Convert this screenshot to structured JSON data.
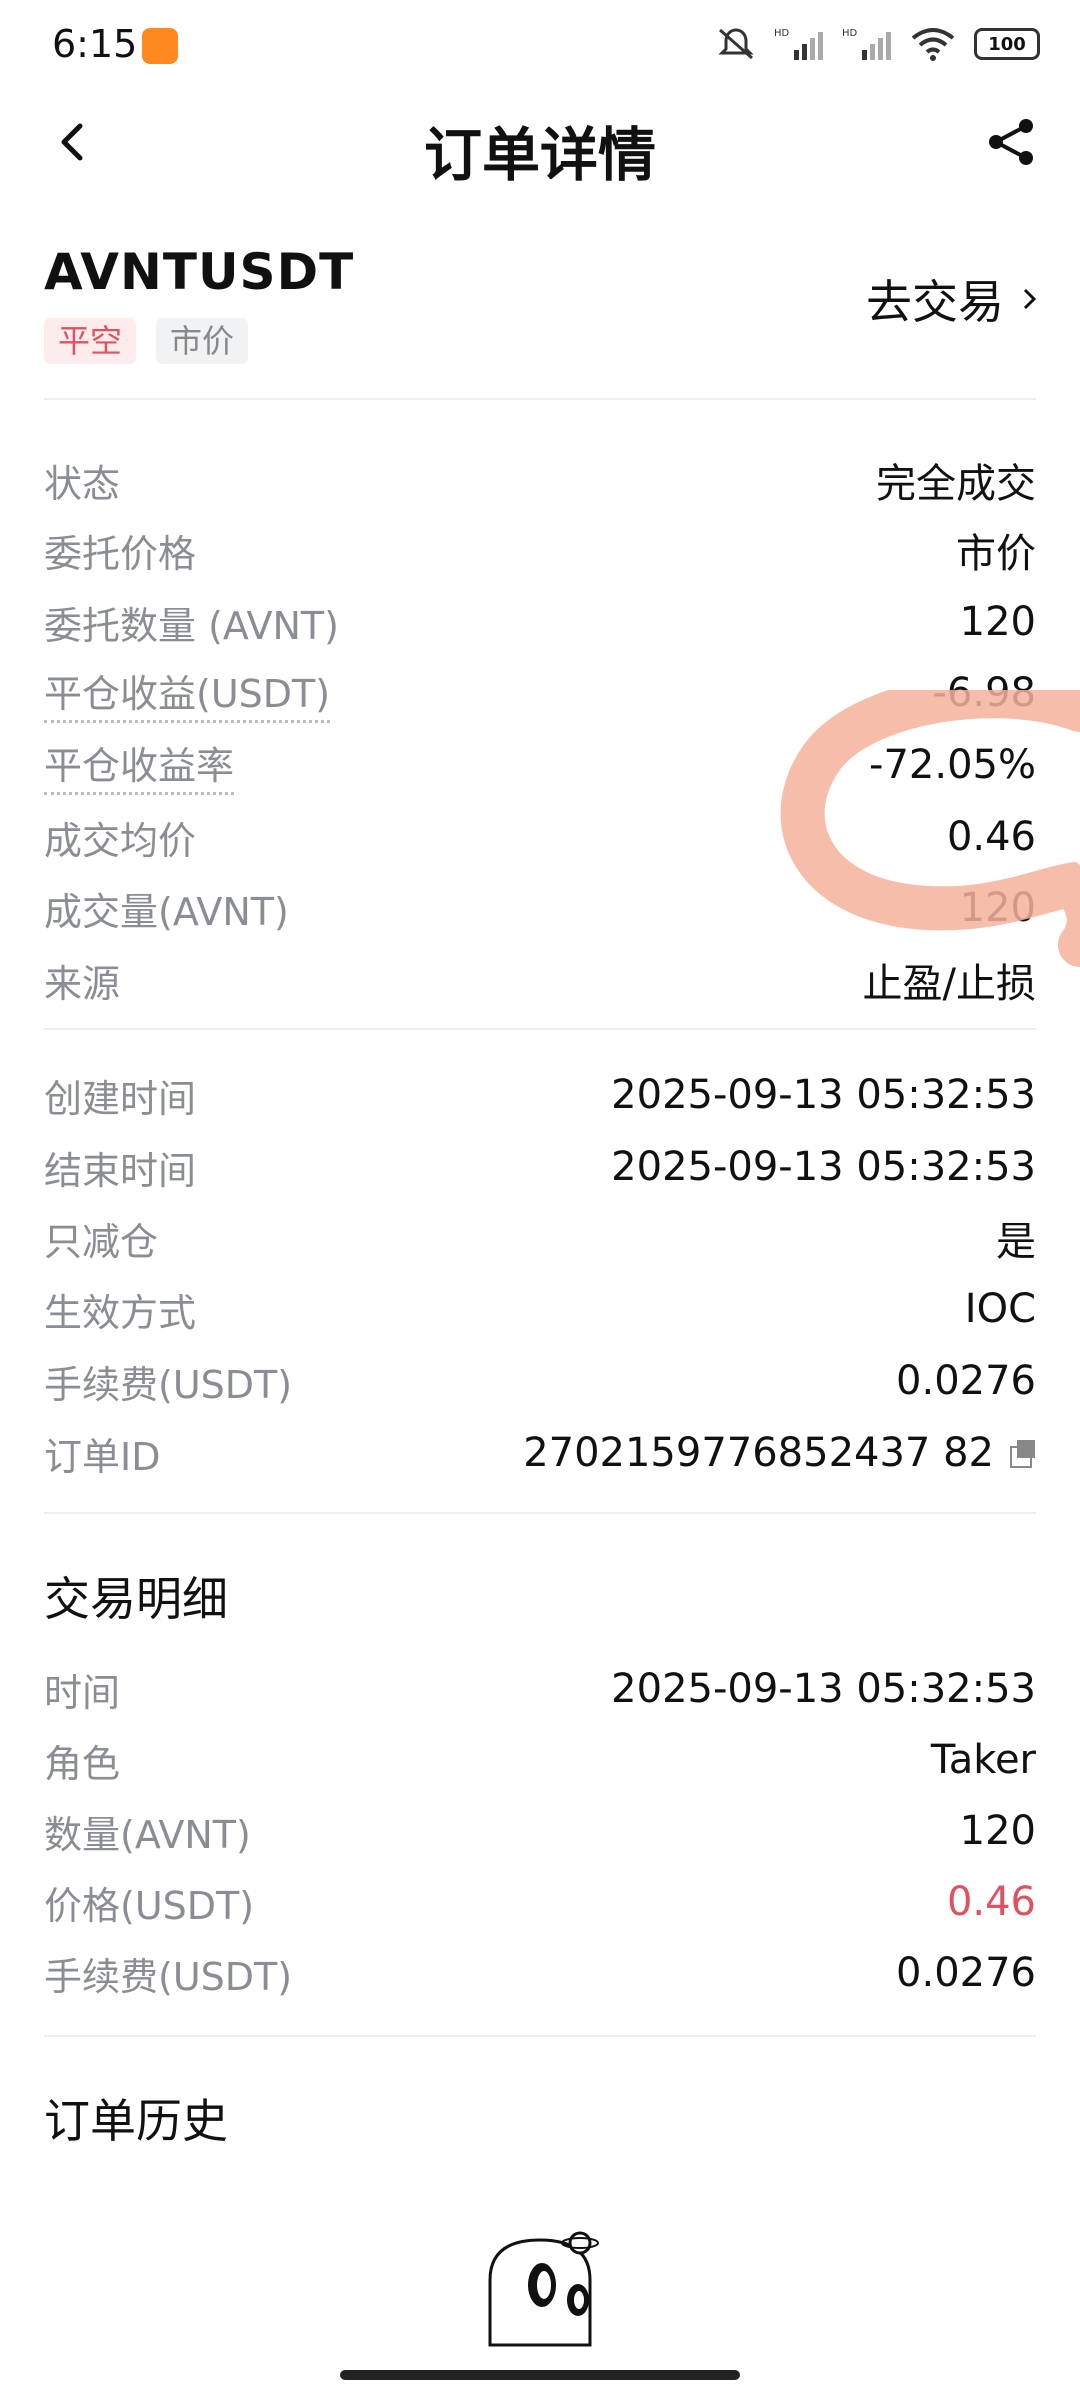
{
  "status_bar": {
    "time": "6:15",
    "battery": "100"
  },
  "header": {
    "title": "订单详情"
  },
  "order": {
    "symbol": "AVNTUSDT",
    "tags": [
      "平空",
      "市价"
    ],
    "go_trade": "去交易"
  },
  "details": [
    {
      "label": "状态",
      "value": "完全成交"
    },
    {
      "label": "委托价格",
      "value": "市价"
    },
    {
      "label": "委托数量 (AVNT)",
      "value": "120"
    },
    {
      "label": "平仓收益(USDT)",
      "value": "-6.98"
    },
    {
      "label": "平仓收益率",
      "value": "-72.05%"
    },
    {
      "label": "成交均价",
      "value": "0.46"
    },
    {
      "label": "成交量(AVNT)",
      "value": "120"
    },
    {
      "label": "来源",
      "value": "止盈/止损"
    }
  ],
  "details2": [
    {
      "label": "创建时间",
      "value": "2025-09-13 05:32:53"
    },
    {
      "label": "结束时间",
      "value": "2025-09-13 05:32:53"
    },
    {
      "label": "只减仓",
      "value": "是"
    },
    {
      "label": "生效方式",
      "value": "IOC"
    },
    {
      "label": "手续费(USDT)",
      "value": "0.0276"
    },
    {
      "label": "订单ID",
      "value": "2702159776852437 82"
    }
  ],
  "trade_detail": {
    "title": "交易明细",
    "rows": [
      {
        "label": "时间",
        "value": "2025-09-13 05:32:53"
      },
      {
        "label": "角色",
        "value": "Taker"
      },
      {
        "label": "数量(AVNT)",
        "value": "120"
      },
      {
        "label": "价格(USDT)",
        "value": "0.46"
      },
      {
        "label": "手续费(USDT)",
        "value": "0.0276"
      }
    ]
  },
  "order_history": {
    "title": "订单历史"
  },
  "colors": {
    "accent_red": "#e25161",
    "label_gray": "#8a8d93"
  }
}
